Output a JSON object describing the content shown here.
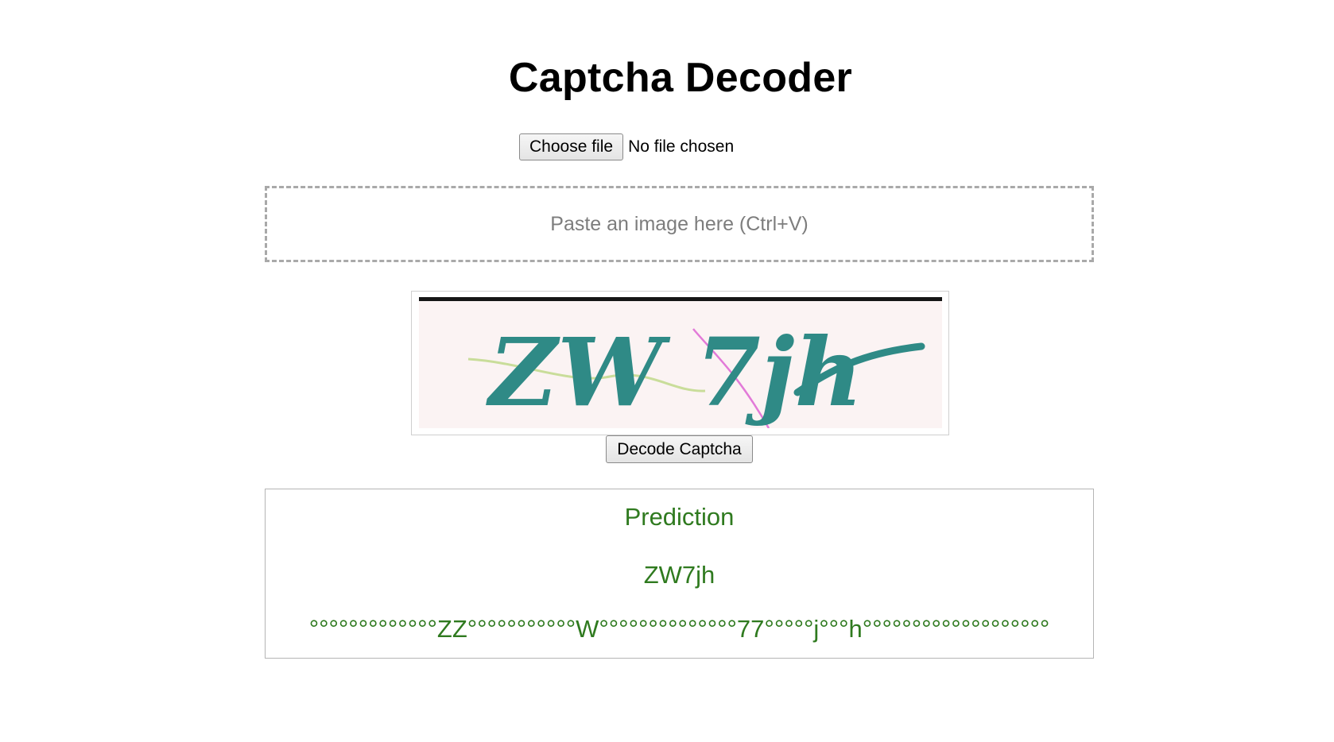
{
  "page": {
    "title": "Captcha Decoder"
  },
  "upload": {
    "choose_button_label": "Choose file",
    "file_status": "No file chosen"
  },
  "paste_zone": {
    "prompt": "Paste an image here (Ctrl+V)"
  },
  "preview": {
    "captcha_text": "ZW 7jh"
  },
  "actions": {
    "decode_button_label": "Decode Captcha"
  },
  "result": {
    "heading": "Prediction",
    "prediction": "ZW7jh",
    "raw_sequence": "°°°°°°°°°°°°°ZZ°°°°°°°°°°°W°°°°°°°°°°°°°°77°°°°°j°°°h°°°°°°°°°°°°°°°°°°°"
  },
  "colors": {
    "result_text": "#2f7a1f",
    "captcha_glyph": "#2f8a86",
    "paste_border": "#a9a9a9"
  }
}
